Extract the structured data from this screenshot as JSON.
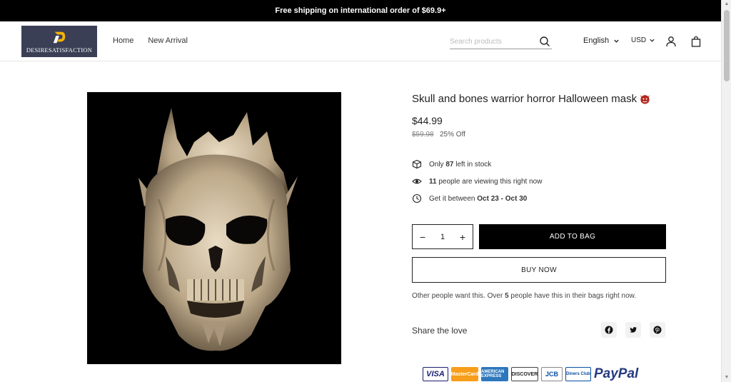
{
  "announcement": "Free shipping on international order of $69.9+",
  "logo": {
    "text": "DESIRESATISFACTION"
  },
  "nav": {
    "items": [
      "Home",
      "New Arrival"
    ]
  },
  "search": {
    "placeholder": "Search products"
  },
  "language": {
    "selected": "English"
  },
  "currency": {
    "selected": "USD"
  },
  "product": {
    "title": "Skull and bones warrior horror Halloween mask",
    "price": "$44.99",
    "compare_price": "$59.98",
    "discount": "25% Off",
    "stock_prefix": "Only",
    "stock_count": "87",
    "stock_suffix": "left in stock",
    "viewers_count": "11",
    "viewers_suffix": "people are viewing this right now",
    "delivery_prefix": "Get it between",
    "delivery_from": "Oct 23",
    "delivery_sep": "-",
    "delivery_to": "Oct 30",
    "quantity": "1",
    "add_to_bag": "ADD TO BAG",
    "buy_now": "BUY NOW",
    "others_prefix": "Other people want this. Over",
    "others_count": "5",
    "others_suffix": "people have this in their bags right now."
  },
  "share": {
    "label": "Share the love",
    "icons": [
      "facebook-icon",
      "twitter-icon",
      "pinterest-icon"
    ]
  },
  "payments": [
    "VISA",
    "MasterCard",
    "AMERICAN EXPRESS",
    "DISCOVER",
    "JCB",
    "Diners Club",
    "PayPal"
  ],
  "colors": {
    "accent": "#000000",
    "announcement_bg": "#000000",
    "logo_bg": "#3a3f55"
  }
}
